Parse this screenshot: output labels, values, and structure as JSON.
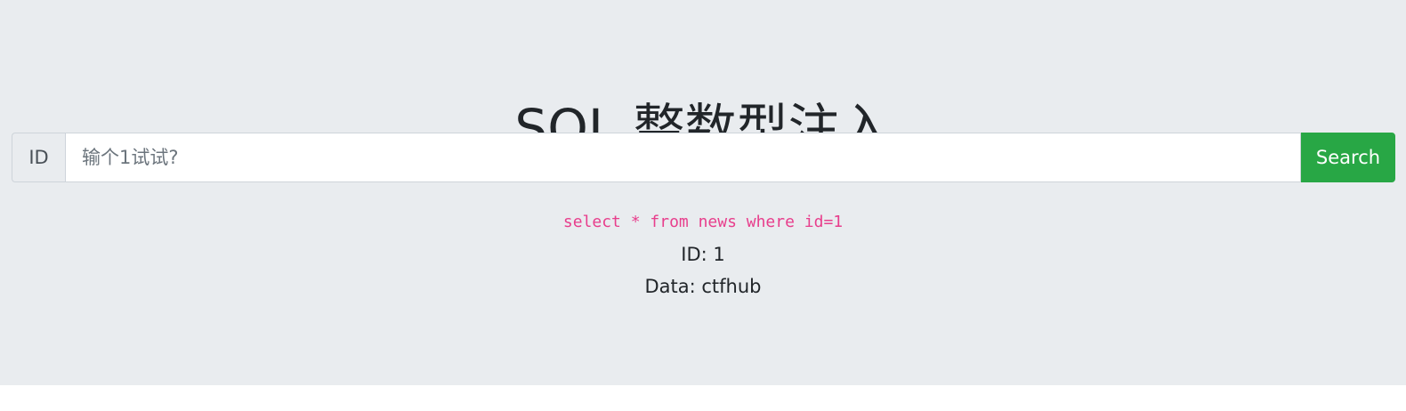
{
  "page": {
    "title": "SQL 整数型注入"
  },
  "search": {
    "addon_label": "ID",
    "placeholder": "输个1试试?",
    "value": "",
    "button_label": "Search"
  },
  "result": {
    "query": "select * from news where id=1",
    "id_line": "ID: 1",
    "data_line": "Data: ctfhub"
  },
  "colors": {
    "background": "#e9ecef",
    "button": "#28a745",
    "query_text": "#e83e8c"
  }
}
